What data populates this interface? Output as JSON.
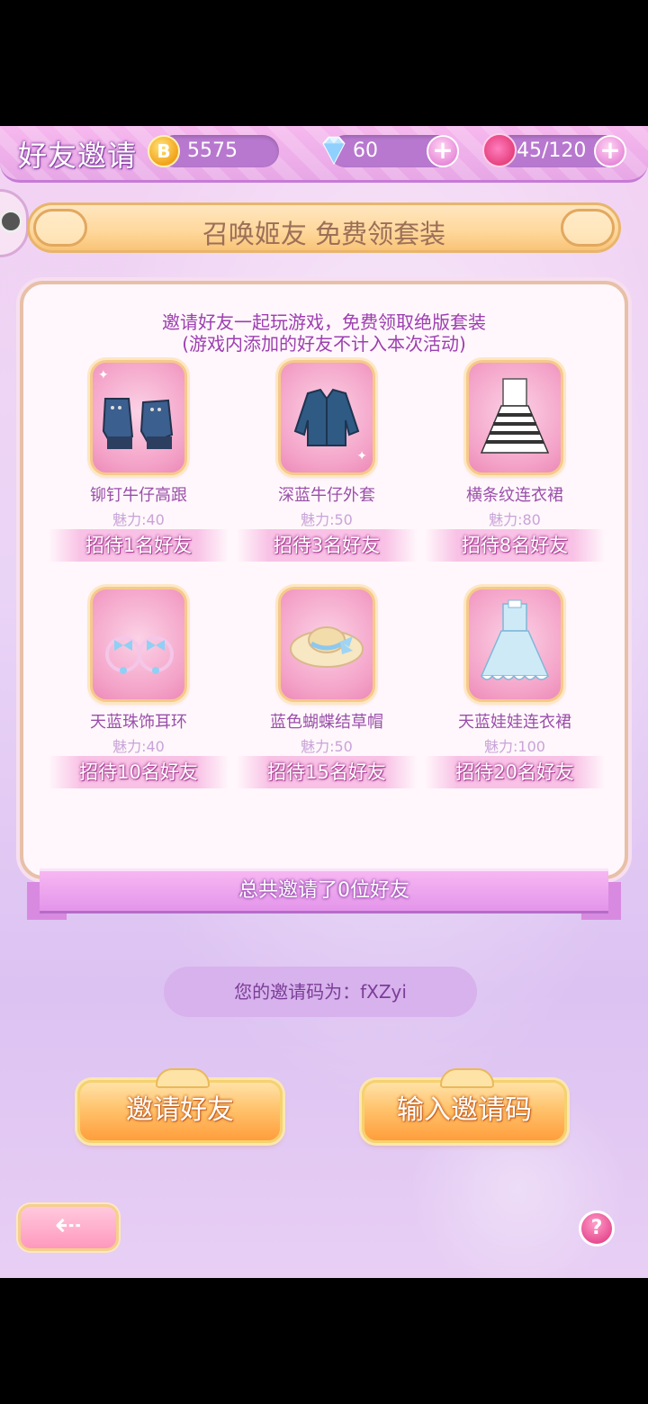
{
  "header": {
    "title": "好友邀请",
    "coins": "5575",
    "diamonds": "60",
    "stamina": "45/120",
    "coin_symbol": "B",
    "plus_symbol": "+"
  },
  "banner": {
    "text": "召唤姬友 免费领套装"
  },
  "panel": {
    "line1": "邀请好友一起玩游戏，免费领取绝版套装",
    "line2": "(游戏内添加的好友不计入本次活动)"
  },
  "rewards": [
    {
      "name": "铆钉牛仔高跟",
      "charm": "魅力:40",
      "requirement": "招待1名好友",
      "icon": "shoes-icon"
    },
    {
      "name": "深蓝牛仔外套",
      "charm": "魅力:50",
      "requirement": "招待3名好友",
      "icon": "jacket-icon"
    },
    {
      "name": "横条纹连衣裙",
      "charm": "魅力:80",
      "requirement": "招待8名好友",
      "icon": "striped-dress-icon"
    },
    {
      "name": "天蓝珠饰耳环",
      "charm": "魅力:40",
      "requirement": "招待10名好友",
      "icon": "earrings-icon"
    },
    {
      "name": "蓝色蝴蝶结草帽",
      "charm": "魅力:50",
      "requirement": "招待15名好友",
      "icon": "straw-hat-icon"
    },
    {
      "name": "天蓝娃娃连衣裙",
      "charm": "魅力:100",
      "requirement": "招待20名好友",
      "icon": "doll-dress-icon"
    }
  ],
  "ribbon": {
    "text": "总共邀请了0位好友"
  },
  "invite_code": {
    "text": "您的邀请码为：fXZyi"
  },
  "buttons": {
    "invite_friends": "邀请好友",
    "enter_code": "输入邀请码",
    "back_symbol": "⇠",
    "help_symbol": "?"
  }
}
